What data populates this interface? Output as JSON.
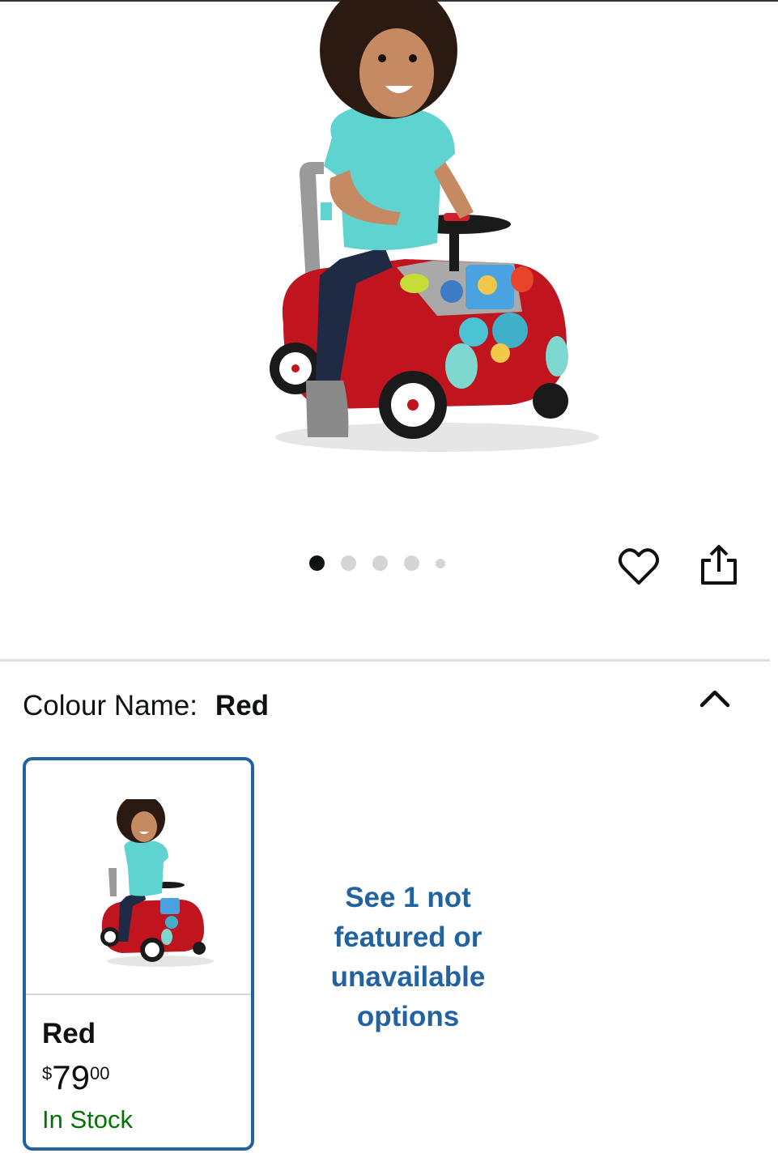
{
  "gallery": {
    "image_alt": "Toddler riding red ride-on push car",
    "dots_total": 5,
    "active_dot": 1
  },
  "actions": {
    "wishlist_icon": "heart-icon",
    "share_icon": "share-icon"
  },
  "variation": {
    "label": "Colour Name:",
    "selected": "Red",
    "collapse_icon": "chevron-up-icon"
  },
  "swatch": {
    "name": "Red",
    "currency": "$",
    "price_whole": "79",
    "price_fraction": "00",
    "availability": "In Stock"
  },
  "see_more": "See 1 not featured or unavailable options",
  "colors": {
    "selected_border": "#2162a1",
    "link": "#2162a1",
    "in_stock": "#007600",
    "car_red": "#c0141f",
    "shirt": "#5fd3cf"
  }
}
